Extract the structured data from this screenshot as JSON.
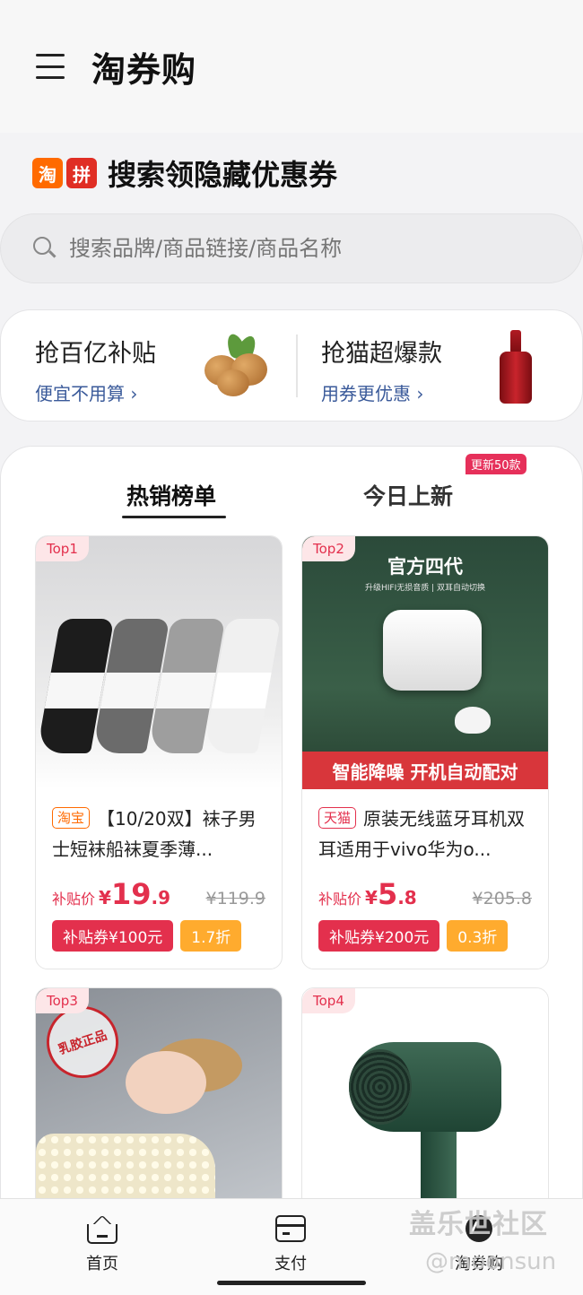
{
  "header": {
    "title": "淘券购",
    "menu_icon": "menu-icon"
  },
  "search_section": {
    "logos": [
      "淘",
      "拼"
    ],
    "title": "搜索领隐藏优惠券",
    "placeholder": "搜索品牌/商品链接/商品名称"
  },
  "promos": [
    {
      "title": "抢百亿补贴",
      "subtitle": "便宜不用算 ›"
    },
    {
      "title": "抢猫超爆款",
      "subtitle": "用券更优惠 ›"
    }
  ],
  "tabs": [
    {
      "label": "热销榜单",
      "active": true
    },
    {
      "label": "今日上新",
      "badge": "更新50款"
    }
  ],
  "products": [
    {
      "rank": "Top1",
      "shop": "淘宝",
      "name": "【10/20双】袜子男士短袜船袜夏季薄...",
      "price_label": "补贴价",
      "price_symbol": "¥",
      "price_int": "19",
      "price_dec": ".9",
      "original_price": "¥119.9",
      "coupon": "补贴券¥100元",
      "discount": "1.7折"
    },
    {
      "rank": "Top2",
      "shop": "天猫",
      "name": "原装无线蓝牙耳机双耳适用于vivo华为o...",
      "price_label": "补贴价",
      "price_symbol": "¥",
      "price_int": "5",
      "price_dec": ".8",
      "original_price": "¥205.8",
      "coupon": "补贴券¥200元",
      "discount": "0.3折",
      "image_text": {
        "title": "官方四代",
        "subtitle": "升级HIFI无损音质 | 双耳自动切换",
        "banner": "智能降噪  开机自动配对"
      }
    },
    {
      "rank": "Top3",
      "image_text": {
        "stamp": "乳胶正品"
      }
    },
    {
      "rank": "Top4"
    }
  ],
  "bottom_nav": [
    {
      "label": "首页",
      "icon": "home-icon"
    },
    {
      "label": "支付",
      "icon": "card-icon"
    },
    {
      "label": "淘券购",
      "icon": "taoquan-icon"
    }
  ],
  "watermark": {
    "line1": "盖乐世社区",
    "line2": "@moonsun"
  }
}
